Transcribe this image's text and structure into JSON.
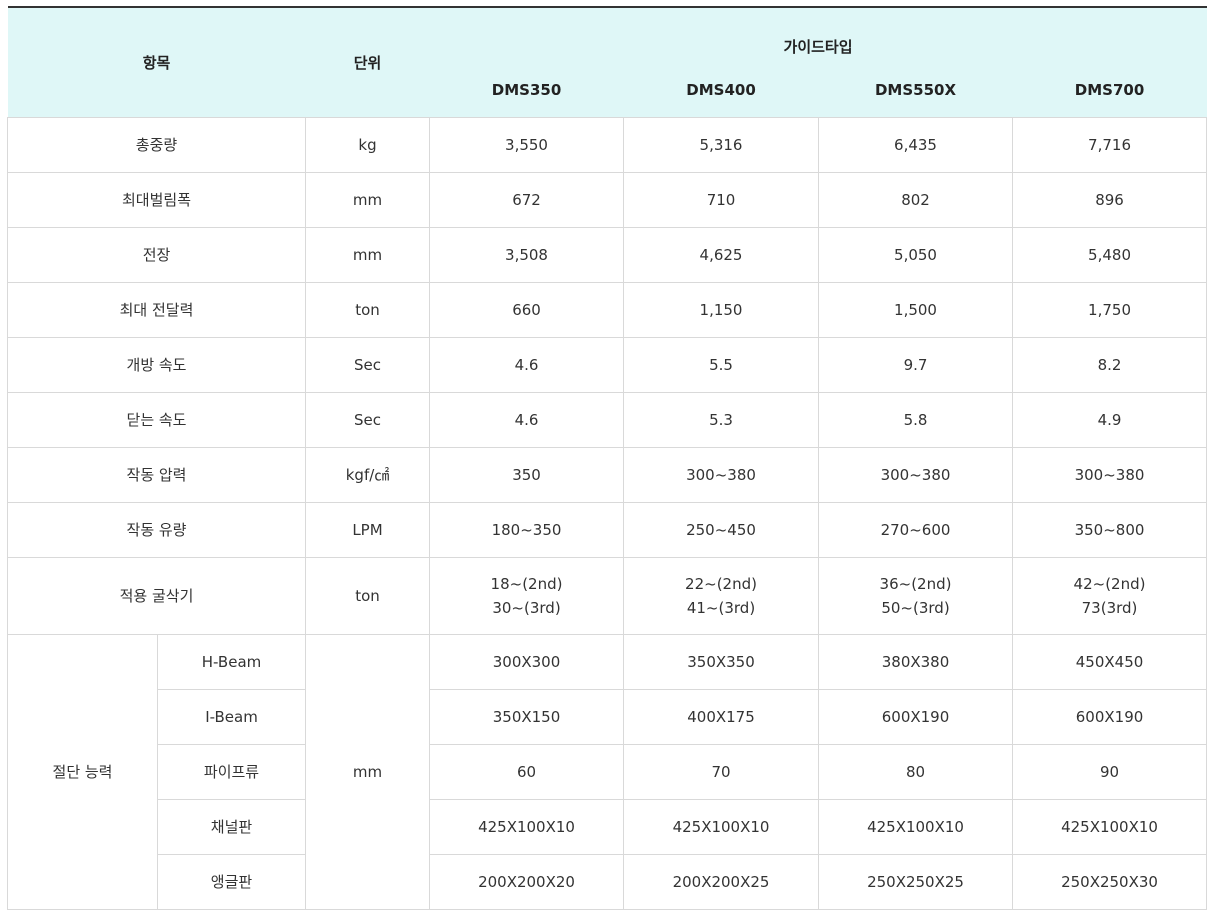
{
  "header": {
    "item_label": "항목",
    "unit_label": "단위",
    "group_label": "가이드타입",
    "models": [
      "DMS350",
      "DMS400",
      "DMS550X",
      "DMS700"
    ]
  },
  "rows": [
    {
      "label": "총중량",
      "unit": "kg",
      "values": [
        "3,550",
        "5,316",
        "6,435",
        "7,716"
      ]
    },
    {
      "label": "최대벌림폭",
      "unit": "mm",
      "values": [
        "672",
        "710",
        "802",
        "896"
      ]
    },
    {
      "label": "전장",
      "unit": "mm",
      "values": [
        "3,508",
        "4,625",
        "5,050",
        "5,480"
      ]
    },
    {
      "label": "최대 전달력",
      "unit": "ton",
      "values": [
        "660",
        "1,150",
        "1,500",
        "1,750"
      ]
    },
    {
      "label": "개방 속도",
      "unit": "Sec",
      "values": [
        "4.6",
        "5.5",
        "9.7",
        "8.2"
      ]
    },
    {
      "label": "닫는 속도",
      "unit": "Sec",
      "values": [
        "4.6",
        "5.3",
        "5.8",
        "4.9"
      ]
    },
    {
      "label": "작동 압력",
      "unit": "kgf/㎠",
      "values": [
        "350",
        "300~380",
        "300~380",
        "300~380"
      ]
    },
    {
      "label": "작동 유량",
      "unit": "LPM",
      "values": [
        "180~350",
        "250~450",
        "270~600",
        "350~800"
      ]
    }
  ],
  "excavator": {
    "label": "적용 굴삭기",
    "unit": "ton",
    "values": [
      [
        "18~(2nd)",
        "30~(3rd)"
      ],
      [
        "22~(2nd)",
        "41~(3rd)"
      ],
      [
        "36~(2nd)",
        "50~(3rd)"
      ],
      [
        "42~(2nd)",
        "73(3rd)"
      ]
    ]
  },
  "cutting": {
    "label": "절단 능력",
    "unit": "mm",
    "rows": [
      {
        "label": "H-Beam",
        "values": [
          "300X300",
          "350X350",
          "380X380",
          "450X450"
        ]
      },
      {
        "label": "I-Beam",
        "values": [
          "350X150",
          "400X175",
          "600X190",
          "600X190"
        ]
      },
      {
        "label": "파이프류",
        "values": [
          "60",
          "70",
          "80",
          "90"
        ]
      },
      {
        "label": "채널판",
        "values": [
          "425X100X10",
          "425X100X10",
          "425X100X10",
          "425X100X10"
        ]
      },
      {
        "label": "앵글판",
        "values": [
          "200X200X20",
          "200X200X25",
          "250X250X25",
          "250X250X30"
        ]
      }
    ]
  }
}
